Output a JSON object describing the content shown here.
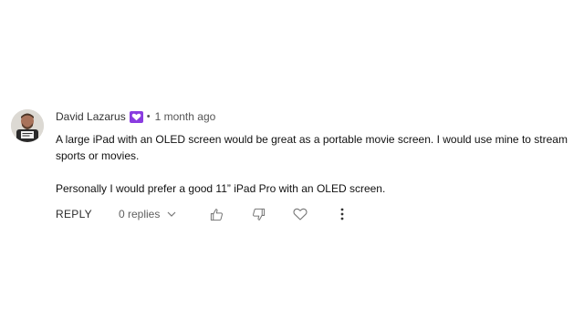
{
  "comment": {
    "author": "David Lazarus",
    "separator": "•",
    "time": "1 month ago",
    "paragraphs": [
      "A large iPad with an OLED screen would be great as a portable movie screen. I would use mine to stream sports or movies.",
      "Personally I would prefer a good  11” iPad Pro with an OLED screen."
    ],
    "actions": {
      "reply_label": "REPLY",
      "replies_label": "0 replies"
    },
    "icons": {
      "badge": "heart-badge-icon",
      "chevron": "chevron-down-icon",
      "like": "thumbs-up-icon",
      "dislike": "thumbs-down-icon",
      "heart": "heart-icon",
      "more": "more-vertical-icon"
    },
    "colors": {
      "badge": "#8a3ce0",
      "icon": "#777777"
    }
  }
}
